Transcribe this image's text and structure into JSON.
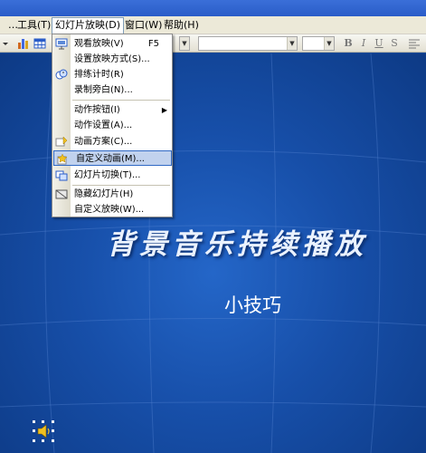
{
  "menubar": {
    "items": [
      {
        "label": "工具(T)"
      },
      {
        "label": "幻灯片放映(D)",
        "active": true
      },
      {
        "label": "窗口(W)"
      },
      {
        "label": "帮助(H)"
      }
    ]
  },
  "toolbar": {
    "icons": [
      "chart-icon",
      "table-icon"
    ],
    "format_buttons": [
      "B",
      "I",
      "U",
      "S"
    ]
  },
  "menu": {
    "items": [
      {
        "label": "观看放映(V)",
        "shortcut": "F5",
        "icon": "slideshow-icon"
      },
      {
        "label": "设置放映方式(S)..."
      },
      {
        "label": "排练计时(R)",
        "icon": "timer-icon"
      },
      {
        "label": "录制旁白(N)..."
      },
      {
        "label": "动作按钮(I)",
        "has_submenu": true
      },
      {
        "label": "动作设置(A)..."
      },
      {
        "label": "动画方案(C)...",
        "icon": "animation-scheme-icon"
      },
      {
        "label": "自定义动画(M)...",
        "icon": "custom-animation-icon",
        "highlighted": true
      },
      {
        "label": "幻灯片切换(T)...",
        "icon": "slide-transition-icon"
      },
      {
        "label": "隐藏幻灯片(H)",
        "icon": "hide-slide-icon"
      },
      {
        "label": "自定义放映(W)..."
      }
    ]
  },
  "slide": {
    "title": "背景音乐持续播放",
    "subtitle": "小技巧",
    "icon": "speaker-icon"
  },
  "colors": {
    "menubar_bg": "#ece9d8",
    "slide_bg": "#174fa9",
    "highlight": "#c1d2ee",
    "highlight_border": "#316ac5"
  }
}
